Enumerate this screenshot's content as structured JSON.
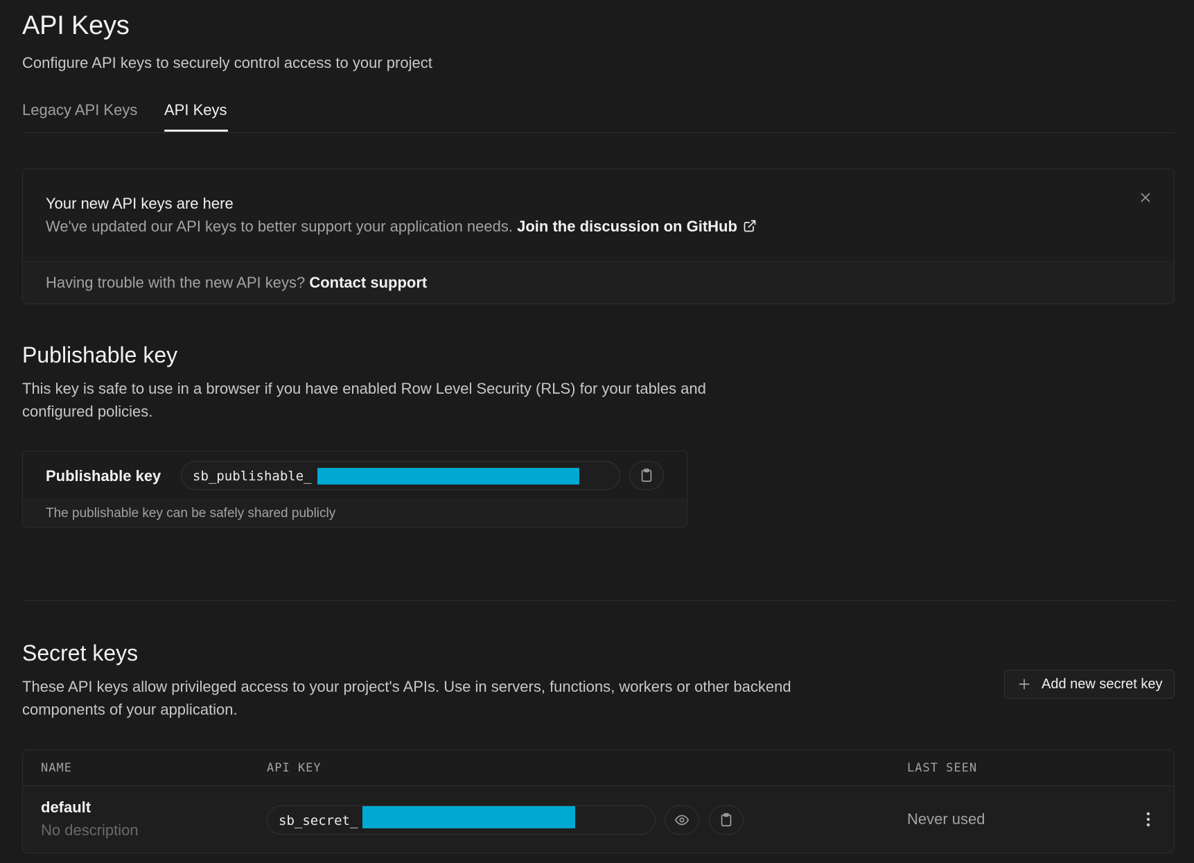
{
  "header": {
    "title": "API Keys",
    "subtitle": "Configure API keys to securely control access to your project"
  },
  "tabs": [
    {
      "label": "Legacy API Keys",
      "active": false
    },
    {
      "label": "API Keys",
      "active": true
    }
  ],
  "notice": {
    "title": "Your new API keys are here",
    "text": "We've updated our API keys to better support your application needs.",
    "link": "Join the discussion on GitHub",
    "trouble_text": "Having trouble with the new API keys?",
    "support_link": "Contact support"
  },
  "publishable": {
    "title": "Publishable key",
    "description": "This key is safe to use in a browser if you have enabled Row Level Security (RLS) for your tables and configured policies.",
    "label": "Publishable key",
    "key_prefix": "sb_publishable_",
    "hint": "The publishable key can be safely shared publicly"
  },
  "secret": {
    "title": "Secret keys",
    "description": "These API keys allow privileged access to your project's APIs. Use in servers, functions, workers or other backend components of your application.",
    "add_button": "Add new secret key",
    "columns": [
      "NAME",
      "API KEY",
      "LAST SEEN"
    ],
    "rows": [
      {
        "name": "default",
        "description": "No description",
        "key_prefix": "sb_secret_",
        "last_seen": "Never used"
      }
    ]
  },
  "colors": {
    "background": "#1b1b1b",
    "redaction": "#00a9d1",
    "text_primary": "#f2f2f2",
    "text_muted": "#a3a3a3"
  },
  "icons": [
    "external-link-icon",
    "close-icon",
    "clipboard-icon",
    "eye-icon",
    "plus-icon",
    "more-vertical-icon"
  ]
}
